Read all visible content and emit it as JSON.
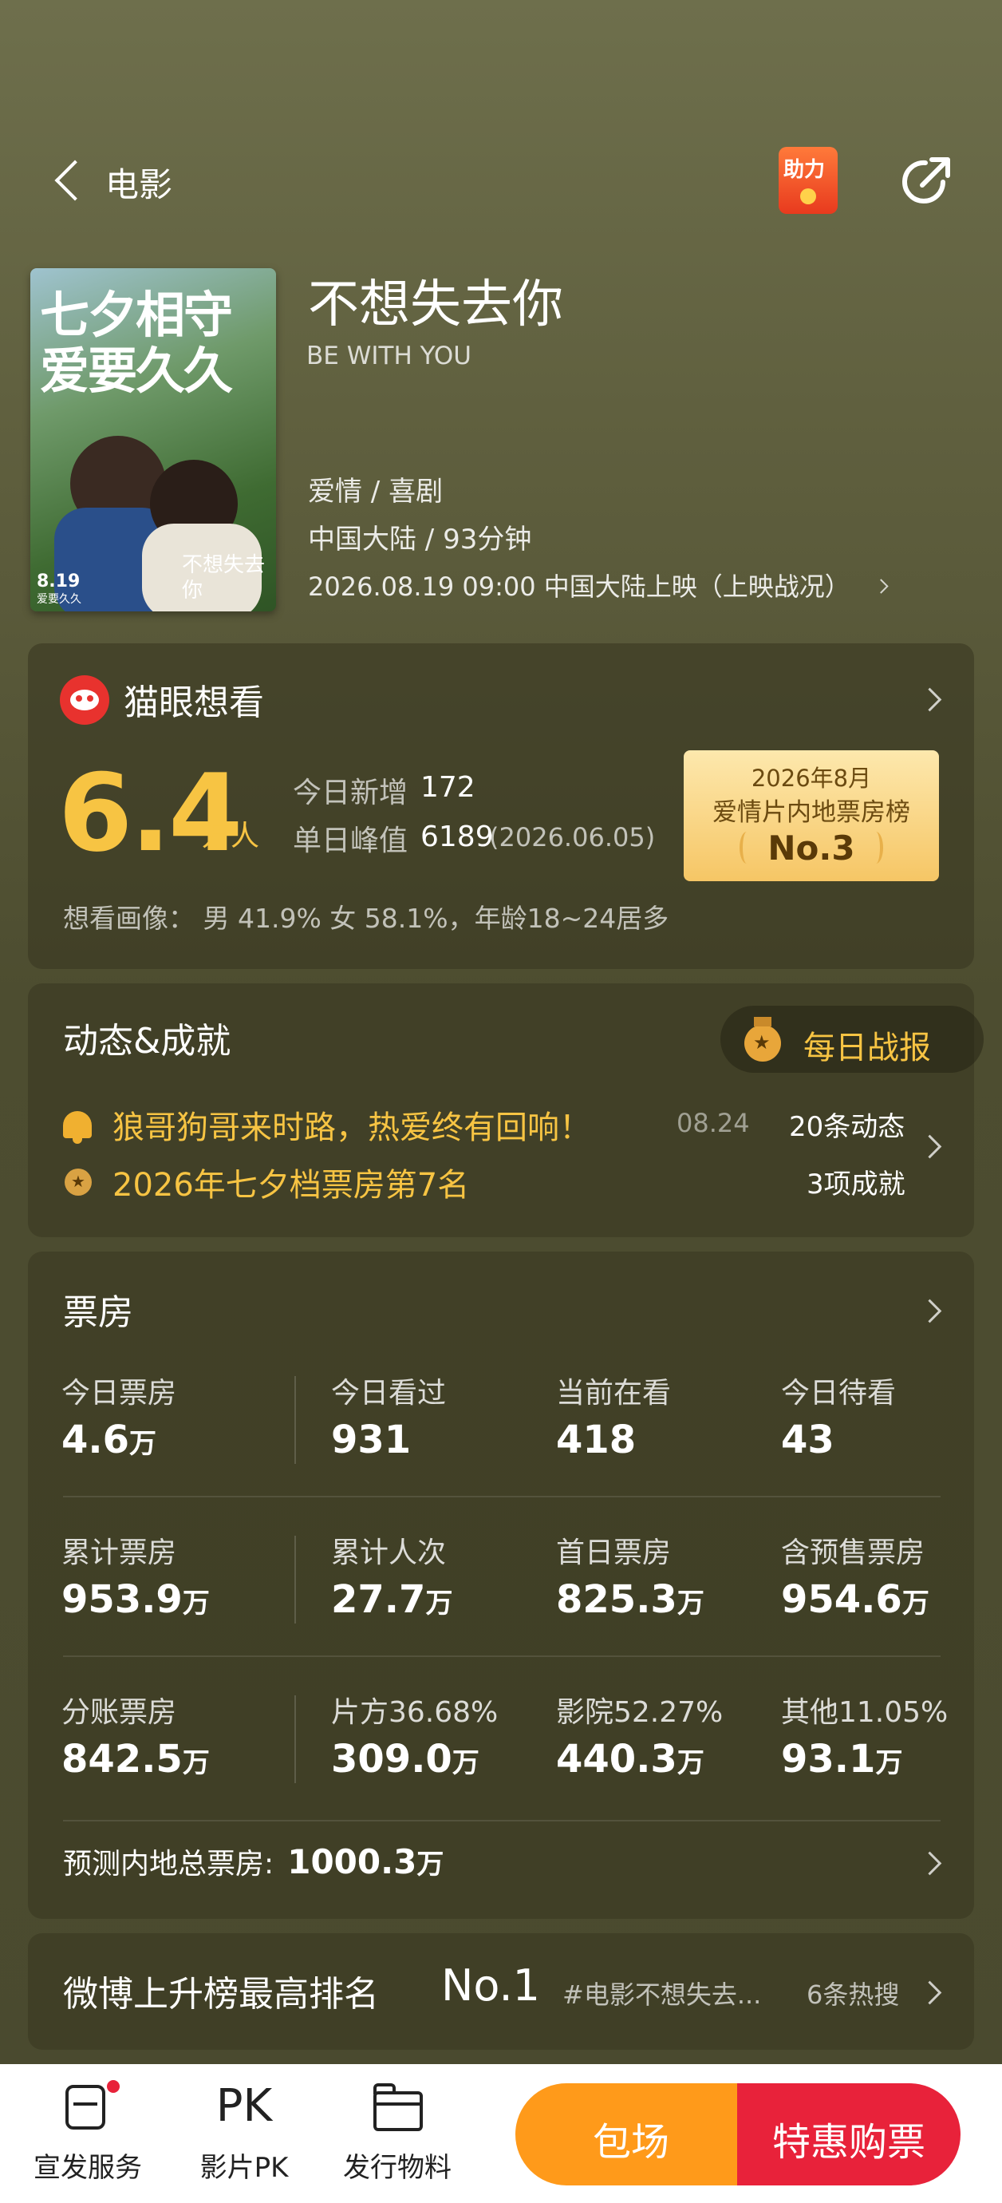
{
  "header": {
    "back_label": "电影",
    "assist_badge": "助力"
  },
  "movie": {
    "poster_line1": "七夕相守",
    "poster_line2": "爱要久久",
    "poster_date": "8.19",
    "poster_date_sub": "爱要久久",
    "poster_logo": "不想失去你",
    "title": "不想失去你",
    "english_title": "BE WITH YOU",
    "genre": "爱情 / 喜剧",
    "region_duration": "中国大陆 / 93分钟",
    "release": "2026.08.19 09:00 中国大陆上映（上映战况）"
  },
  "want": {
    "title": "猫眼想看",
    "count": "6.4",
    "count_unit": "万人",
    "today_label": "今日新增",
    "today_value": "172",
    "peak_label": "单日峰值",
    "peak_value": "6189",
    "peak_date": "(2026.06.05)",
    "rank_period": "2026年8月",
    "rank_name": "爱情片内地票房榜",
    "rank_value": "No.3",
    "portrait": "想看画像： 男 41.9% 女 58.1%，年龄18~24居多"
  },
  "news": {
    "title": "动态&成就",
    "daily_report": "每日战报",
    "item1_text": "狼哥狗哥来时路，热爱终有回响！",
    "item1_date": "08.24",
    "item1_count": "20条动态",
    "item2_text": "2026年七夕档票房第7名",
    "item2_count": "3项成就"
  },
  "boxoffice": {
    "title": "票房",
    "rows": [
      [
        {
          "label": "今日票房",
          "value": "4.6",
          "unit": "万"
        },
        {
          "label": "今日看过",
          "value": "931",
          "unit": ""
        },
        {
          "label": "当前在看",
          "value": "418",
          "unit": ""
        },
        {
          "label": "今日待看",
          "value": "43",
          "unit": ""
        }
      ],
      [
        {
          "label": "累计票房",
          "value": "953.9",
          "unit": "万"
        },
        {
          "label": "累计人次",
          "value": "27.7",
          "unit": "万"
        },
        {
          "label": "首日票房",
          "value": "825.3",
          "unit": "万"
        },
        {
          "label": "含预售票房",
          "value": "954.6",
          "unit": "万"
        }
      ],
      [
        {
          "label": "分账票房",
          "value": "842.5",
          "unit": "万"
        },
        {
          "label": "片方36.68%",
          "value": "309.0",
          "unit": "万"
        },
        {
          "label": "影院52.27%",
          "value": "440.3",
          "unit": "万"
        },
        {
          "label": "其他11.05%",
          "value": "93.1",
          "unit": "万"
        }
      ]
    ],
    "forecast_label": "预测内地总票房:",
    "forecast_value": "1000.3",
    "forecast_unit": "万"
  },
  "weibo": {
    "label": "微博上升榜最高排名",
    "rank": "No.1",
    "tag": "#电影不想失去...",
    "hot": "6条热搜"
  },
  "bottom_bar": {
    "items": [
      {
        "label": "宣发服务",
        "icon": "service-icon"
      },
      {
        "label": "影片PK",
        "icon": "pk-icon"
      },
      {
        "label": "发行物料",
        "icon": "folder-icon"
      }
    ],
    "pk_glyph": "PK",
    "book_label": "包场",
    "buy_label": "特惠购票"
  },
  "colors": {
    "accent_gold": "#f7c443",
    "orange": "#ff9a1a",
    "red": "#e8223a",
    "background": "#5a5a3a"
  }
}
